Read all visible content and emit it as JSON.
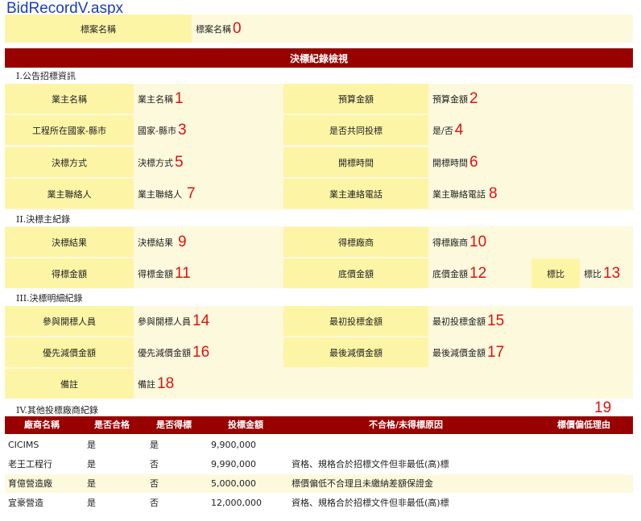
{
  "page_title": "BidRecordV.aspx",
  "case": {
    "label": "標案名稱",
    "value": "標案名稱",
    "num": "0"
  },
  "header": "決標紀錄檢視",
  "sections": {
    "s1": "I.公告招標資訊",
    "s2": "II.決標主紀錄",
    "s3": "III.決標明細紀錄",
    "s4": "IV.其他投標廠商紀錄"
  },
  "fields": {
    "owner": {
      "label": "業主名稱",
      "value": "業主名稱",
      "num": "1"
    },
    "budget": {
      "label": "預算金額",
      "value": "預算金額",
      "num": "2"
    },
    "location": {
      "label": "工程所在國家-縣市",
      "value": "國家-縣市",
      "num": "3"
    },
    "joint": {
      "label": "是否共同投標",
      "value": "是/否",
      "num": "4"
    },
    "method": {
      "label": "決標方式",
      "value": "決標方式",
      "num": "5"
    },
    "open_time": {
      "label": "開標時間",
      "value": "開標時間",
      "num": "6"
    },
    "contact": {
      "label": "業主聯絡人",
      "value": "業主聯絡人",
      "num": "7"
    },
    "phone": {
      "label": "業主連絡電話",
      "value": "業主聯絡電話",
      "num": "8"
    },
    "result": {
      "label": "決標結果",
      "value": "決標結果",
      "num": "9"
    },
    "winner": {
      "label": "得標廠商",
      "value": "得標廠商",
      "num": "10"
    },
    "win_amount": {
      "label": "得標金額",
      "value": "得標金額",
      "num": "11"
    },
    "base_price": {
      "label": "底價金額",
      "value": "底價金額",
      "num": "12"
    },
    "ratio": {
      "label": "標比",
      "value": "標比",
      "num": "13"
    },
    "attendee": {
      "label": "參與開標人員",
      "value": "參與開標人員",
      "num": "14"
    },
    "first_bid": {
      "label": "最初投標金額",
      "value": "最初投標金額",
      "num": "15"
    },
    "priority_cut": {
      "label": "優先減價金額",
      "value": "優先減價金額",
      "num": "16"
    },
    "final_cut": {
      "label": "最後減價金額",
      "value": "最後減價金額",
      "num": "17"
    },
    "note": {
      "label": "備註",
      "value": "備註",
      "num": "18"
    }
  },
  "table": {
    "num": "19",
    "headers": [
      "廠商名稱",
      "是否合格",
      "是否得標",
      "投標金額",
      "不合格/未得標原因",
      "標價偏低理由"
    ],
    "rows": [
      [
        "CICIMS",
        "是",
        "是",
        "9,900,000",
        ""
      ],
      [
        "老王工程行",
        "是",
        "否",
        "9,990,000",
        "資格、規格合於招標文件但非最低(高)標"
      ],
      [
        "育億營造廠",
        "是",
        "否",
        "5,000,000",
        "標價偏低不合理且未繳納差額保證金"
      ],
      [
        "宜豪營造",
        "是",
        "否",
        "12,000,000",
        "資格、規格合於招標文件但非最低(高)標"
      ]
    ]
  }
}
